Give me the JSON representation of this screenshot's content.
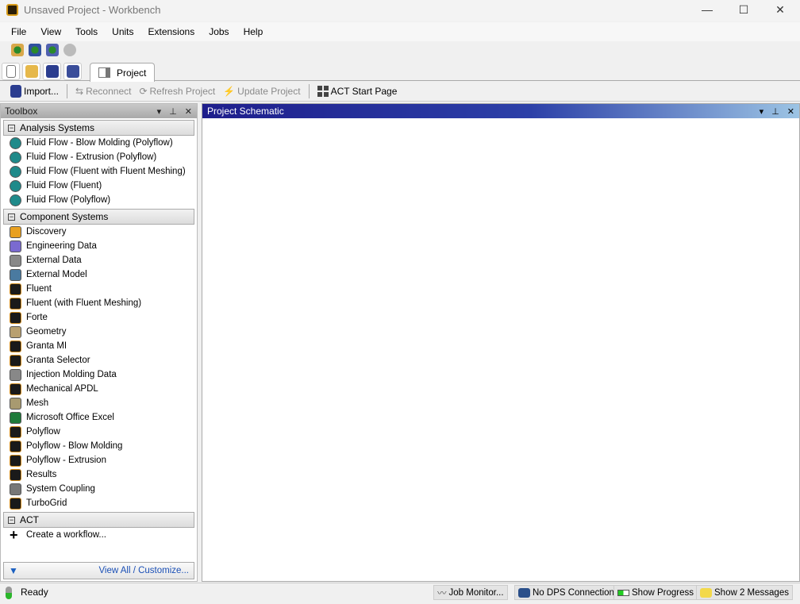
{
  "window": {
    "title": "Unsaved Project - Workbench",
    "min": "—",
    "max": "☐",
    "close": "✕"
  },
  "menu": [
    "File",
    "View",
    "Tools",
    "Units",
    "Extensions",
    "Jobs",
    "Help"
  ],
  "tab": {
    "label": "Project"
  },
  "toolbar": {
    "import": "Import...",
    "reconnect": "Reconnect",
    "refresh": "Refresh Project",
    "update": "Update Project",
    "act": "ACT Start Page"
  },
  "toolbox": {
    "title": "Toolbox",
    "groups": [
      {
        "label": "Analysis Systems",
        "items": [
          "Fluid Flow - Blow Molding (Polyflow)",
          "Fluid Flow - Extrusion (Polyflow)",
          "Fluid Flow (Fluent with Fluent Meshing)",
          "Fluid Flow (Fluent)",
          "Fluid Flow (Polyflow)"
        ]
      },
      {
        "label": "Component Systems",
        "items": [
          "Discovery",
          "Engineering Data",
          "External Data",
          "External Model",
          "Fluent",
          "Fluent (with Fluent Meshing)",
          "Forte",
          "Geometry",
          "Granta MI",
          "Granta Selector",
          "Injection Molding Data",
          "Mechanical APDL",
          "Mesh",
          "Microsoft Office Excel",
          "Polyflow",
          "Polyflow - Blow Molding",
          "Polyflow - Extrusion",
          "Results",
          "System Coupling",
          "TurboGrid"
        ]
      },
      {
        "label": "ACT",
        "items": [
          "Create a workflow..."
        ]
      }
    ],
    "footer": "View All / Customize..."
  },
  "schematic": {
    "title": "Project Schematic"
  },
  "panel_buttons": {
    "dropdown": "▾",
    "pin": "⊥",
    "close": "✕"
  },
  "status": {
    "text": "Ready",
    "job_monitor": "Job Monitor...",
    "dps": "No DPS Connection",
    "progress": "Show Progress",
    "messages": "Show 2 Messages"
  }
}
